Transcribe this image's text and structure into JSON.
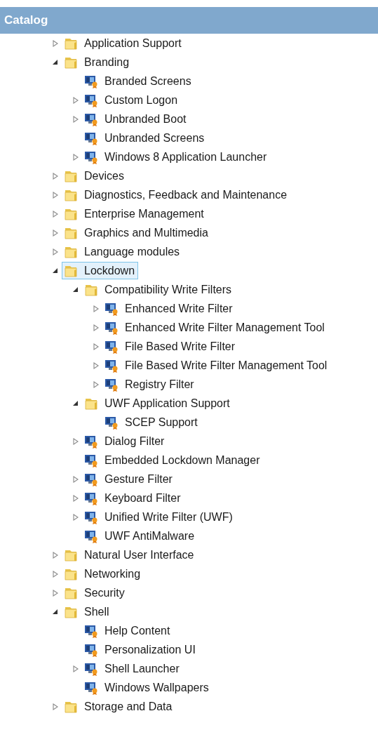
{
  "header": {
    "title": "Catalog"
  },
  "tree": [
    {
      "label": "Application Support",
      "kind": "folder",
      "expanded": false,
      "selected": false
    },
    {
      "label": "Branding",
      "kind": "folder",
      "expanded": true,
      "selected": false,
      "children": [
        {
          "label": "Branded Screens",
          "kind": "component",
          "selected": false
        },
        {
          "label": "Custom Logon",
          "kind": "component",
          "expanded": false,
          "selected": false
        },
        {
          "label": "Unbranded Boot",
          "kind": "component",
          "expanded": false,
          "selected": false
        },
        {
          "label": "Unbranded Screens",
          "kind": "component",
          "selected": false
        },
        {
          "label": "Windows 8 Application Launcher",
          "kind": "component",
          "expanded": false,
          "selected": false
        }
      ]
    },
    {
      "label": "Devices",
      "kind": "folder",
      "expanded": false,
      "selected": false
    },
    {
      "label": "Diagnostics, Feedback and Maintenance",
      "kind": "folder",
      "expanded": false,
      "selected": false
    },
    {
      "label": "Enterprise Management",
      "kind": "folder",
      "expanded": false,
      "selected": false
    },
    {
      "label": "Graphics and Multimedia",
      "kind": "folder",
      "expanded": false,
      "selected": false
    },
    {
      "label": "Language modules",
      "kind": "folder",
      "expanded": false,
      "selected": false
    },
    {
      "label": "Lockdown",
      "kind": "folder",
      "expanded": true,
      "selected": true,
      "children": [
        {
          "label": "Compatibility Write Filters",
          "kind": "folder",
          "expanded": true,
          "selected": false,
          "children": [
            {
              "label": "Enhanced Write Filter",
              "kind": "component",
              "expanded": false,
              "selected": false
            },
            {
              "label": "Enhanced Write Filter Management Tool",
              "kind": "component",
              "expanded": false,
              "selected": false
            },
            {
              "label": "File Based Write Filter",
              "kind": "component",
              "expanded": false,
              "selected": false
            },
            {
              "label": "File Based Write Filter Management Tool",
              "kind": "component",
              "expanded": false,
              "selected": false
            },
            {
              "label": "Registry Filter",
              "kind": "component",
              "expanded": false,
              "selected": false
            }
          ]
        },
        {
          "label": "UWF Application Support",
          "kind": "folder",
          "expanded": true,
          "selected": false,
          "children": [
            {
              "label": "SCEP Support",
              "kind": "component",
              "selected": false
            }
          ]
        },
        {
          "label": "Dialog Filter",
          "kind": "component",
          "expanded": false,
          "selected": false
        },
        {
          "label": "Embedded Lockdown Manager",
          "kind": "component",
          "selected": false
        },
        {
          "label": "Gesture Filter",
          "kind": "component",
          "expanded": false,
          "selected": false
        },
        {
          "label": "Keyboard Filter",
          "kind": "component",
          "expanded": false,
          "selected": false
        },
        {
          "label": "Unified Write Filter (UWF)",
          "kind": "component",
          "expanded": false,
          "selected": false
        },
        {
          "label": "UWF AntiMalware",
          "kind": "component",
          "selected": false
        }
      ]
    },
    {
      "label": "Natural User Interface",
      "kind": "folder",
      "expanded": false,
      "selected": false
    },
    {
      "label": "Networking",
      "kind": "folder",
      "expanded": false,
      "selected": false
    },
    {
      "label": "Security",
      "kind": "folder",
      "expanded": false,
      "selected": false
    },
    {
      "label": "Shell",
      "kind": "folder",
      "expanded": true,
      "selected": false,
      "children": [
        {
          "label": "Help Content",
          "kind": "component",
          "selected": false
        },
        {
          "label": "Personalization UI",
          "kind": "component",
          "selected": false
        },
        {
          "label": "Shell Launcher",
          "kind": "component",
          "expanded": false,
          "selected": false
        },
        {
          "label": "Windows Wallpapers",
          "kind": "component",
          "selected": false
        }
      ]
    },
    {
      "label": "Storage and Data",
      "kind": "folder",
      "expanded": false,
      "selected": false
    }
  ]
}
